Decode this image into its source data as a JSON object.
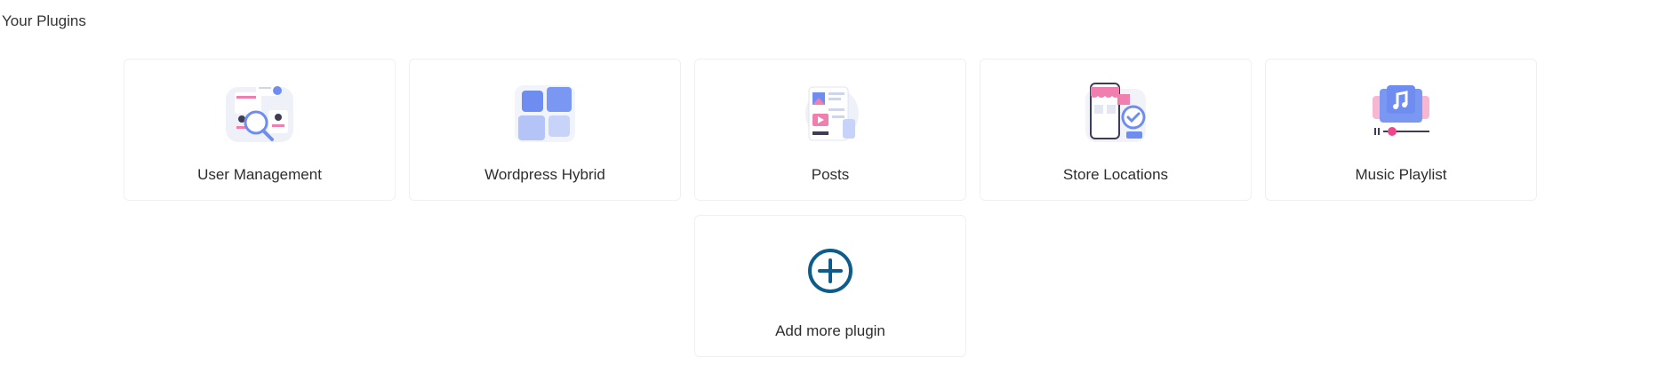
{
  "header": {
    "title": "Your Plugins"
  },
  "plugins": [
    {
      "label": "User Management",
      "icon": "user-management-icon"
    },
    {
      "label": "Wordpress Hybrid",
      "icon": "wordpress-hybrid-icon"
    },
    {
      "label": "Posts",
      "icon": "posts-icon"
    },
    {
      "label": "Store Locations",
      "icon": "store-locations-icon"
    },
    {
      "label": "Music Playlist",
      "icon": "music-playlist-icon"
    }
  ],
  "add_plugin": {
    "label": "Add more plugin",
    "icon": "add-circle-icon"
  },
  "colors": {
    "accent_blue": "#0e5c8c",
    "icon_blue": "#6f8df0",
    "icon_pink": "#f07fb0",
    "card_border": "#f0f0f0"
  }
}
